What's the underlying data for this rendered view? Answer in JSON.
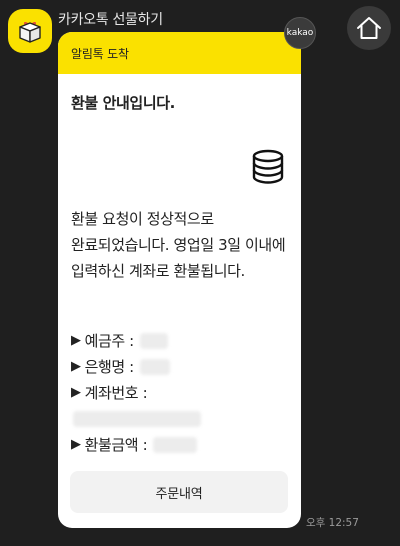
{
  "sender": {
    "name": "카카오톡 선물하기",
    "avatar_icon": "gift-box-icon",
    "avatar_color": "#fae100"
  },
  "home_icon": "home-icon",
  "message": {
    "header": "알림톡 도착",
    "badge": "kakao",
    "title": "환불 안내입니다.",
    "title_icon": "coins-stack-icon",
    "body": "환불 요청이 정상적으로 완료되었습니다. 영업일 3일 이내에 입력하신 계좌로 환불됩니다.",
    "info_marker": "▶",
    "info": {
      "depositor_label": "예금주 :",
      "bank_label": "은행명 :",
      "account_label": "계좌번호 :",
      "amount_label": "환불금액 :"
    },
    "button_label": "주문내역",
    "timestamp": "오후 12:57"
  },
  "colors": {
    "background": "#1f1f1f",
    "accent": "#fae100",
    "card": "#ffffff"
  }
}
